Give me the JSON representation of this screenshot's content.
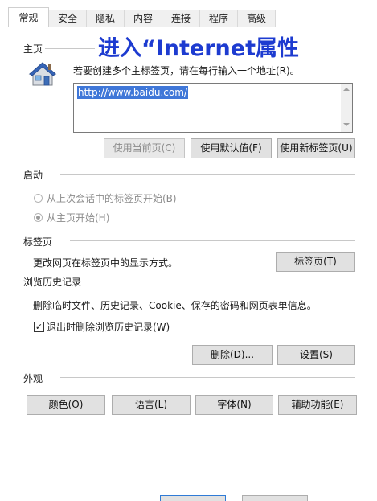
{
  "tabs": [
    {
      "label": "常规",
      "active": true
    },
    {
      "label": "安全",
      "active": false
    },
    {
      "label": "隐私",
      "active": false
    },
    {
      "label": "内容",
      "active": false
    },
    {
      "label": "连接",
      "active": false
    },
    {
      "label": "程序",
      "active": false
    },
    {
      "label": "高级",
      "active": false
    }
  ],
  "overlay_title": "进入“Internet属性",
  "home": {
    "section": "主页",
    "description": "若要创建多个主标签页，请在每行输入一个地址(R)。",
    "url": "http://www.baidu.com/",
    "icon": "home-house-icon",
    "buttons": {
      "use_current": "使用当前页(C)",
      "use_default": "使用默认值(F)",
      "use_new_tab": "使用新标签页(U)"
    }
  },
  "startup": {
    "section": "启动",
    "option_last_session": "从上次会话中的标签页开始(B)",
    "option_home": "从主页开始(H)",
    "selected": "从主页开始(H)"
  },
  "tabs_section": {
    "section": "标签页",
    "description": "更改网页在标签页中的显示方式。",
    "button": "标签页(T)"
  },
  "history": {
    "section": "浏览历史记录",
    "description": "删除临时文件、历史记录、Cookie、保存的密码和网页表单信息。",
    "checkbox_label": "退出时删除浏览历史记录(W)",
    "checked": true,
    "delete_button": "删除(D)...",
    "settings_button": "设置(S)"
  },
  "appearance": {
    "section": "外观",
    "colors": "颜色(O)",
    "languages": "语言(L)",
    "fonts": "字体(N)",
    "accessibility": "辅助功能(E)"
  },
  "colors": {
    "overlay": "#1d3bd0",
    "selection": "#3f77d8",
    "button_face": "#e1e1e1"
  }
}
